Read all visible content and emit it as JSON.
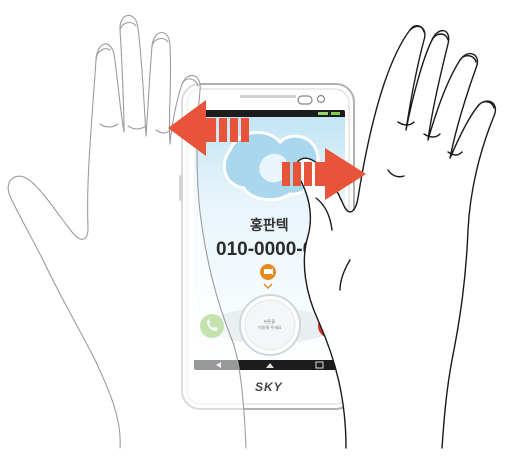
{
  "image": {
    "description_names": {
      "phone": "smartphone",
      "left_hand": "hand-swipe-left",
      "right_hand": "hand-swipe-right"
    }
  },
  "phone": {
    "brand": "SKY",
    "contact_name": "홍판텍",
    "phone_number": "010-0000-0000",
    "center_button_text_line1": "버튼을",
    "center_button_text_line2": "이동해 주세요"
  },
  "gestures": {
    "left_arrow": {
      "direction": "left",
      "color": "#e8543a"
    },
    "right_arrow": {
      "direction": "right",
      "color": "#e8543a"
    }
  },
  "colors": {
    "arrow": "#e8543a",
    "screen_top": "#cfe9f5",
    "accept": "#7bbf4a",
    "reject": "#d9302b",
    "video": "#e68a1f"
  }
}
